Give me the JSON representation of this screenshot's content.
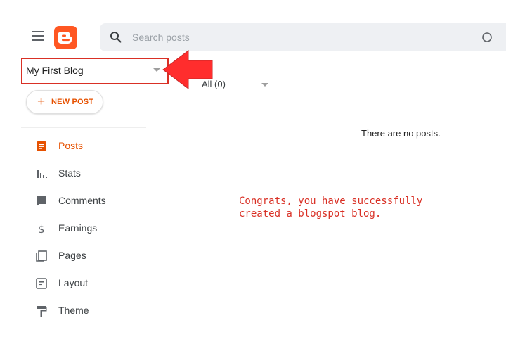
{
  "header": {
    "search": {
      "placeholder": "Search posts",
      "value": ""
    }
  },
  "blog_selector": {
    "name": "My First Blog"
  },
  "new_post": {
    "plus": "+",
    "label": "NEW POST"
  },
  "nav": {
    "items": [
      {
        "label": "Posts",
        "icon": "posts-icon",
        "active": true
      },
      {
        "label": "Stats",
        "icon": "stats-icon",
        "active": false
      },
      {
        "label": "Comments",
        "icon": "comments-icon",
        "active": false
      },
      {
        "label": "Earnings",
        "icon": "dollar-icon",
        "active": false
      },
      {
        "label": "Pages",
        "icon": "pages-icon",
        "active": false
      },
      {
        "label": "Layout",
        "icon": "layout-icon",
        "active": false
      },
      {
        "label": "Theme",
        "icon": "paint-roller-icon",
        "active": false
      }
    ]
  },
  "content": {
    "filter": "All (0)",
    "empty_message": "There are no posts.",
    "annotation": "Congrats, you have successfully created a blogspot blog."
  },
  "colors": {
    "accent": "#e65100",
    "logo": "#ff5722",
    "annotation_red": "#d93025"
  }
}
